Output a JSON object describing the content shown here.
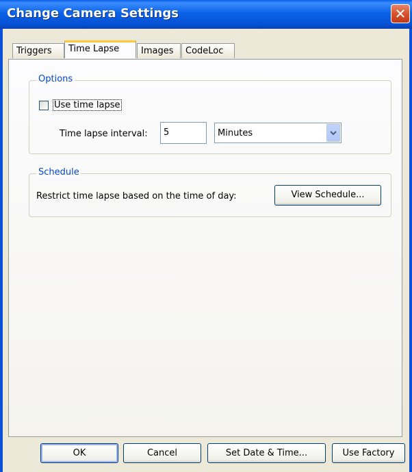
{
  "window": {
    "title": "Change Camera Settings"
  },
  "tabs": [
    {
      "label": "Triggers",
      "active": false
    },
    {
      "label": "Time Lapse",
      "active": true
    },
    {
      "label": "Images",
      "active": false
    },
    {
      "label": "CodeLoc",
      "active": false
    }
  ],
  "options": {
    "legend": "Options",
    "use_time_lapse": {
      "label": "Use time lapse",
      "checked": false
    },
    "interval": {
      "label": "Time lapse interval:",
      "value": "5",
      "unit": "Minutes"
    }
  },
  "schedule": {
    "legend": "Schedule",
    "description": "Restrict time lapse based on the time of day:",
    "button_label": "View Schedule..."
  },
  "buttons": {
    "ok": "OK",
    "cancel": "Cancel",
    "set_date_time": "Set Date & Time...",
    "use_factory": "Use Factory"
  },
  "icons": {
    "close": "close-icon",
    "dropdown": "chevron-down-icon"
  }
}
